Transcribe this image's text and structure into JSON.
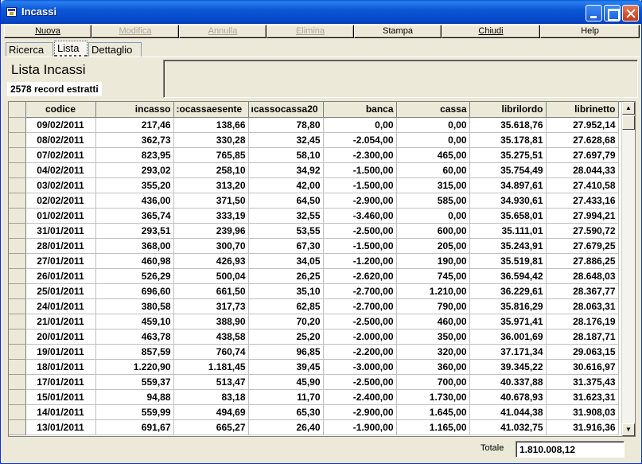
{
  "window": {
    "title": "Incassi"
  },
  "toolbar": {
    "buttons": [
      {
        "label": "Nuova",
        "enabled": true
      },
      {
        "label": "Modifica",
        "enabled": false
      },
      {
        "label": "Annulla",
        "enabled": false
      },
      {
        "label": "Elimina",
        "enabled": false
      },
      {
        "label": "Stampa",
        "enabled": true
      },
      {
        "label": "Chiudi",
        "enabled": true
      },
      {
        "label": "Help",
        "enabled": true
      }
    ]
  },
  "tabs": [
    {
      "label": "Ricerca",
      "active": false
    },
    {
      "label": "Lista",
      "active": true
    },
    {
      "label": "Dettaglio",
      "active": false
    }
  ],
  "list": {
    "title": "Lista Incassi",
    "record_count": "2578 record estratti"
  },
  "table": {
    "columns": [
      "codice",
      "incasso",
      ":ocassaesente",
      "ıcassocassa20",
      "banca",
      "cassa",
      "librilordo",
      "librinetto"
    ],
    "rows": [
      [
        "09/02/2011",
        "217,46",
        "138,66",
        "78,80",
        "0,00",
        "0,00",
        "35.618,76",
        "27.952,14"
      ],
      [
        "08/02/2011",
        "362,73",
        "330,28",
        "32,45",
        "-2.054,00",
        "0,00",
        "35.178,81",
        "27.628,68"
      ],
      [
        "07/02/2011",
        "823,95",
        "765,85",
        "58,10",
        "-2.300,00",
        "465,00",
        "35.275,51",
        "27.697,79"
      ],
      [
        "04/02/2011",
        "293,02",
        "258,10",
        "34,92",
        "-1.500,00",
        "60,00",
        "35.754,49",
        "28.044,33"
      ],
      [
        "03/02/2011",
        "355,20",
        "313,20",
        "42,00",
        "-1.500,00",
        "315,00",
        "34.897,61",
        "27.410,58"
      ],
      [
        "02/02/2011",
        "436,00",
        "371,50",
        "64,50",
        "-2.900,00",
        "585,00",
        "34.930,61",
        "27.433,16"
      ],
      [
        "01/02/2011",
        "365,74",
        "333,19",
        "32,55",
        "-3.460,00",
        "0,00",
        "35.658,01",
        "27.994,21"
      ],
      [
        "31/01/2011",
        "293,51",
        "239,96",
        "53,55",
        "-2.500,00",
        "600,00",
        "35.111,01",
        "27.590,72"
      ],
      [
        "28/01/2011",
        "368,00",
        "300,70",
        "67,30",
        "-1.500,00",
        "205,00",
        "35.243,91",
        "27.679,25"
      ],
      [
        "27/01/2011",
        "460,98",
        "426,93",
        "34,05",
        "-1.200,00",
        "190,00",
        "35.519,81",
        "27.886,25"
      ],
      [
        "26/01/2011",
        "526,29",
        "500,04",
        "26,25",
        "-2.620,00",
        "745,00",
        "36.594,42",
        "28.648,03"
      ],
      [
        "25/01/2011",
        "696,60",
        "661,50",
        "35,10",
        "-2.700,00",
        "1.210,00",
        "36.229,61",
        "28.367,77"
      ],
      [
        "24/01/2011",
        "380,58",
        "317,73",
        "62,85",
        "-2.700,00",
        "790,00",
        "35.816,29",
        "28.063,31"
      ],
      [
        "21/01/2011",
        "459,10",
        "388,90",
        "70,20",
        "-2.500,00",
        "460,00",
        "35.971,41",
        "28.176,19"
      ],
      [
        "20/01/2011",
        "463,78",
        "438,58",
        "25,20",
        "-2.000,00",
        "350,00",
        "36.001,69",
        "28.187,71"
      ],
      [
        "19/01/2011",
        "857,59",
        "760,74",
        "96,85",
        "-2.200,00",
        "320,00",
        "37.171,34",
        "29.063,15"
      ],
      [
        "18/01/2011",
        "1.220,90",
        "1.181,45",
        "39,45",
        "-3.000,00",
        "360,00",
        "39.345,22",
        "30.616,97"
      ],
      [
        "17/01/2011",
        "559,37",
        "513,47",
        "45,90",
        "-2.500,00",
        "700,00",
        "40.337,88",
        "31.375,43"
      ],
      [
        "15/01/2011",
        "94,88",
        "83,18",
        "11,70",
        "-2.400,00",
        "1.730,00",
        "40.678,93",
        "31.623,31"
      ],
      [
        "14/01/2011",
        "559,99",
        "494,69",
        "65,30",
        "-2.900,00",
        "1.645,00",
        "41.044,38",
        "31.908,03"
      ],
      [
        "13/01/2011",
        "691,67",
        "665,27",
        "26,40",
        "-1.900,00",
        "1.165,00",
        "41.032,75",
        "31.916,36"
      ]
    ]
  },
  "footer": {
    "total_label": "Totale",
    "total_value": "1.810.008,12"
  }
}
